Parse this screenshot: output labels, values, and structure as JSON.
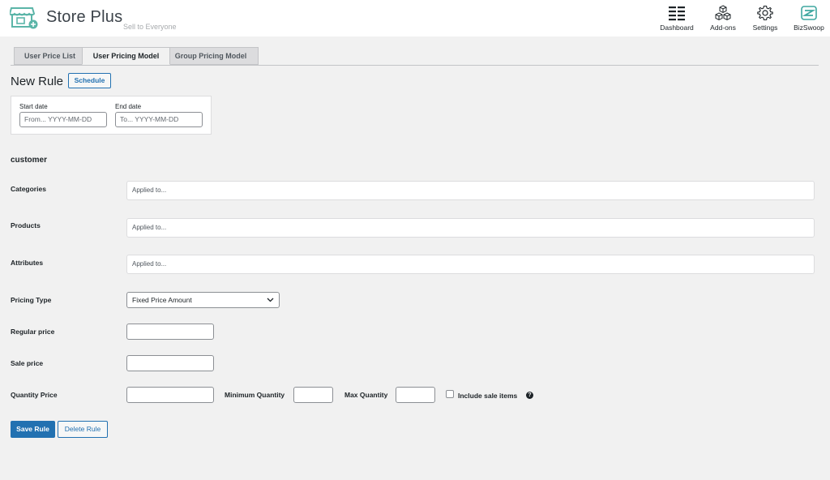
{
  "header": {
    "brand": "Store Plus",
    "tagline": "Sell to Everyone",
    "nav": [
      {
        "label": "Dashboard",
        "icon": "list-icon"
      },
      {
        "label": "Add-ons",
        "icon": "cubes-icon"
      },
      {
        "label": "Settings",
        "icon": "gear-icon"
      },
      {
        "label": "BizSwoop",
        "icon": "bizswoop-logo-icon"
      }
    ]
  },
  "tabs": [
    "User Price List",
    "User Pricing Model",
    "Group Pricing Model"
  ],
  "active_tab": "User Pricing Model",
  "rule": {
    "title": "New Rule",
    "schedule_label": "Schedule",
    "start_date_label": "Start date",
    "start_date_placeholder": "From... YYYY-MM-DD",
    "end_date_label": "End date",
    "end_date_placeholder": "To... YYYY-MM-DD"
  },
  "section": "customer",
  "fields": {
    "categories_label": "Categories",
    "categories_placeholder": "Applied to...",
    "products_label": "Products",
    "products_placeholder": "Applied to...",
    "attributes_label": "Attributes",
    "attributes_placeholder": "Applied to...",
    "pricing_type_label": "Pricing Type",
    "pricing_type_value": "Fixed Price Amount",
    "regular_price_label": "Regular price",
    "sale_price_label": "Sale price",
    "quantity_price_label": "Quantity Price",
    "min_qty_label": "Minimum Quantity",
    "max_qty_label": "Max Quantity",
    "include_sale_label": "Include sale items",
    "help_glyph": "?"
  },
  "actions": {
    "save": "Save Rule",
    "delete": "Delete Rule"
  },
  "colors": {
    "accent": "#2271b1",
    "logo": "#5bb5a8"
  }
}
